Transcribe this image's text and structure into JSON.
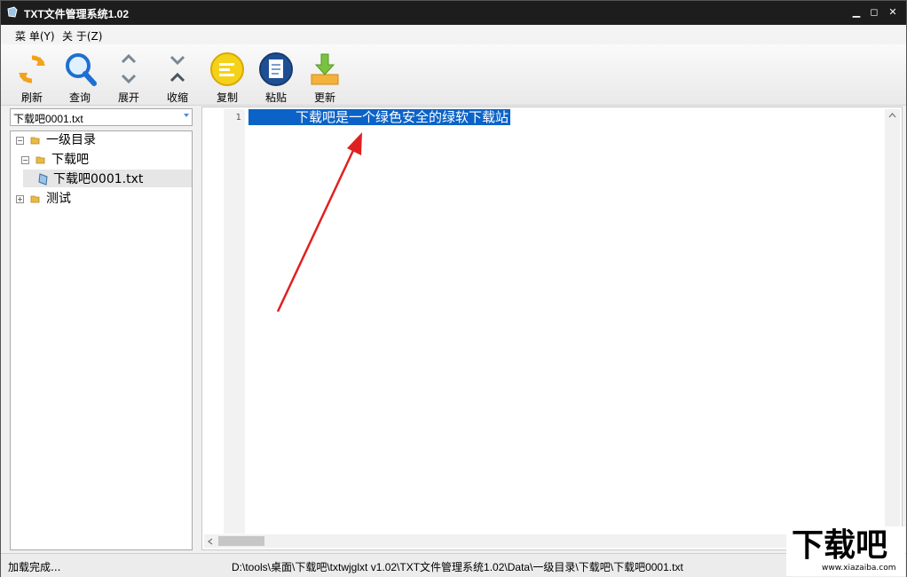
{
  "window": {
    "title": "TXT文件管理系统1.02"
  },
  "menu": [
    {
      "label": "菜 单(Y)"
    },
    {
      "label": "关 于(Z)"
    }
  ],
  "toolbar": [
    {
      "label": "刷新",
      "icon": "refresh-icon"
    },
    {
      "label": "查询",
      "icon": "search-icon"
    },
    {
      "label": "展开",
      "icon": "expand-chevrons-icon"
    },
    {
      "label": "收缩",
      "icon": "collapse-chevrons-icon"
    },
    {
      "label": "复制",
      "icon": "copy-list-icon"
    },
    {
      "label": "粘贴",
      "icon": "paste-document-icon"
    },
    {
      "label": "更新",
      "icon": "download-update-icon"
    }
  ],
  "file_combo": {
    "value": "下载吧0001.txt"
  },
  "tree": [
    {
      "label": "一级目录",
      "expander": "⊟",
      "icon": "folder-icon"
    },
    {
      "label": "下载吧",
      "expander": "⊟",
      "icon": "folder-icon"
    },
    {
      "label": "下载吧0001.txt",
      "icon": "text-file-icon",
      "selected": true
    },
    {
      "label": "测试",
      "expander": "⊞",
      "icon": "folder-icon"
    }
  ],
  "editor": {
    "line_number": "1",
    "line_text": "下载吧是一个绿色安全的绿软下载站"
  },
  "status": {
    "left": "加载完成...",
    "path": "D:\\tools\\桌面\\下载吧\\txtwjglxt v1.02\\TXT文件管理系统1.02\\Data\\一级目录\\下载吧\\下载吧0001.txt"
  },
  "watermark": {
    "text": "下载吧",
    "url": "www.xiazaiba.com"
  },
  "colors": {
    "selection": "#0b63c7",
    "titlebar": "#1d1d1d",
    "arrow": "#e02020"
  }
}
